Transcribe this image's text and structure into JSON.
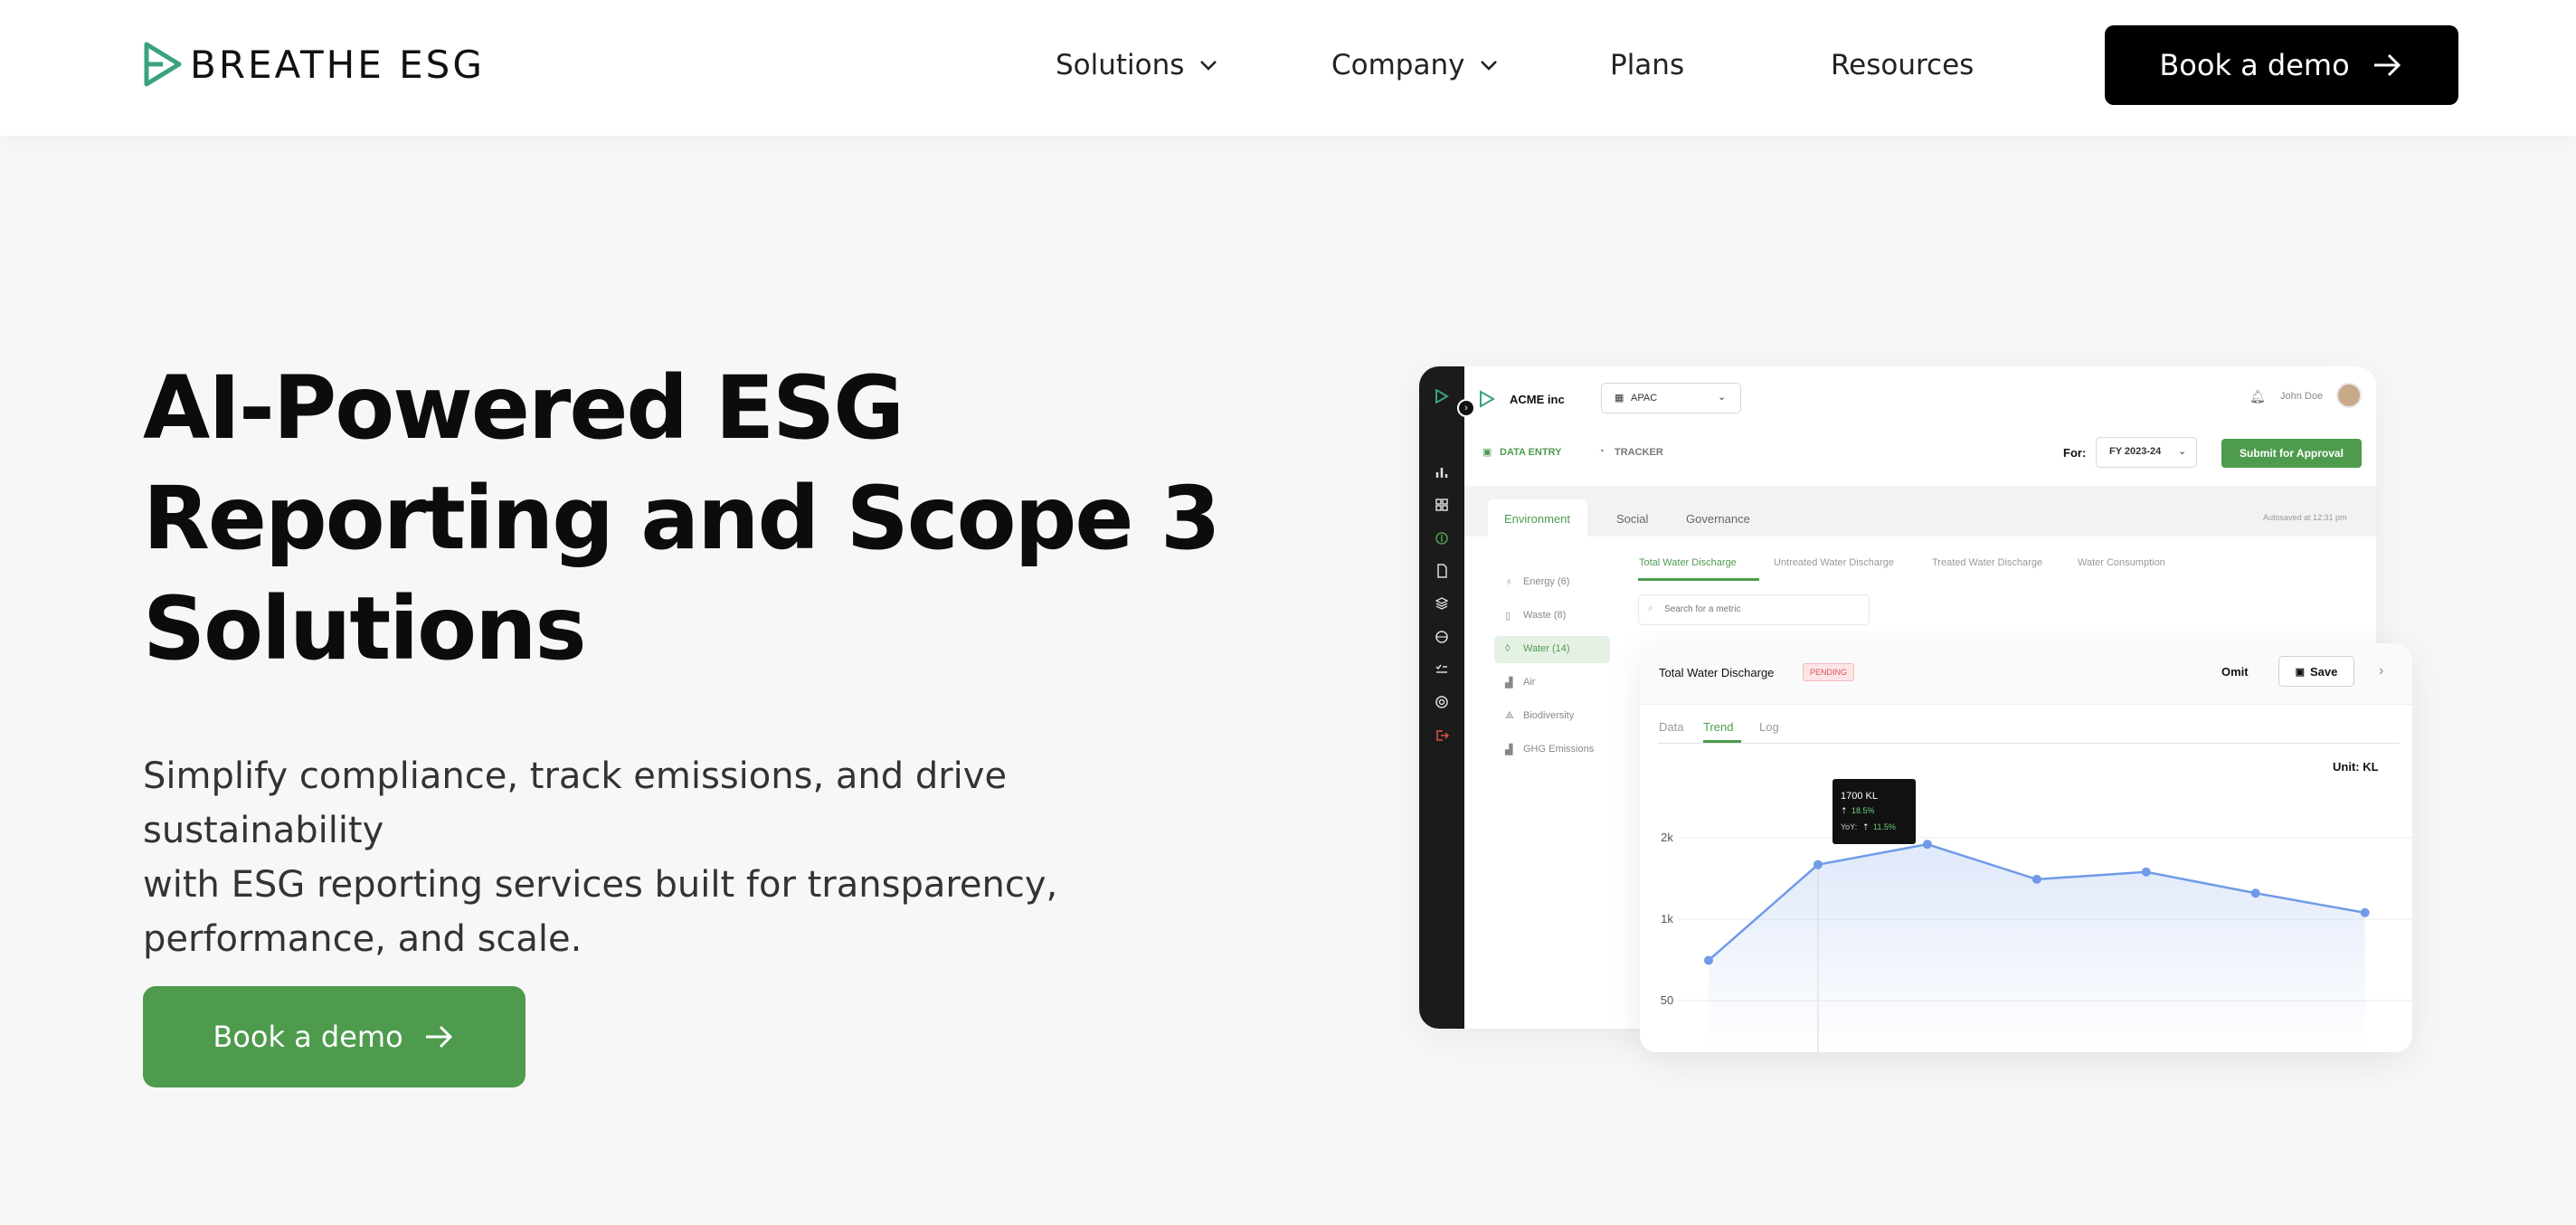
{
  "nav": {
    "logo_text": "BREATHE ESG",
    "items": [
      {
        "label": "Solutions",
        "has_dropdown": true
      },
      {
        "label": "Company",
        "has_dropdown": true
      },
      {
        "label": "Plans",
        "has_dropdown": false
      },
      {
        "label": "Resources",
        "has_dropdown": false
      }
    ],
    "cta_label": "Book a demo"
  },
  "hero": {
    "title_lines": [
      "AI-Powered ESG",
      "Reporting and Scope 3",
      "Solutions"
    ],
    "subtitle_lines": [
      "Simplify compliance, track emissions, and drive sustainability",
      "with ESG reporting services built for transparency,",
      "performance, and scale."
    ],
    "cta_label": "Book a demo"
  },
  "colors": {
    "brand_green": "#4e9b4e",
    "dark": "#000000",
    "chart_line": "#6f9ae8"
  },
  "app": {
    "org_name": "ACME inc",
    "region": "APAC",
    "user_name": "John Doe",
    "mode_tabs": [
      "DATA ENTRY",
      "TRACKER"
    ],
    "for_label": "For:",
    "fiscal_year": "FY 2023-24",
    "submit_label": "Submit for Approval",
    "pillar_tabs": [
      "Environment",
      "Social",
      "Governance"
    ],
    "autosave": "Autosaved at 12:31 pm",
    "categories": [
      "Energy (6)",
      "Waste (8)",
      "Water (14)",
      "Air",
      "Biodiversity",
      "GHG Emissions"
    ],
    "metric_tabs": [
      "Total Water Discharge",
      "Untreated Water Discharge",
      "Treated Water Discharge",
      "Water Consumption"
    ],
    "search_placeholder": "Search for a metric",
    "card": {
      "title": "Total Water Discharge",
      "status": "PENDING",
      "omit_label": "Omit",
      "save_label": "Save",
      "sub_tabs": [
        "Data",
        "Trend",
        "Log"
      ],
      "unit_label": "Unit: KL",
      "tooltip": {
        "value": "1700 KL",
        "change": "18.5%",
        "yoy_label": "YoY:",
        "yoy": "11.5%"
      }
    }
  },
  "chart_data": {
    "type": "area",
    "y_tick_labels": [
      "2k",
      "1k",
      "50"
    ],
    "series": [
      {
        "values": [
          520,
          1670,
          1920,
          1490,
          1580,
          1320,
          1080
        ]
      }
    ],
    "highlighted_index": 1,
    "grid": true
  }
}
